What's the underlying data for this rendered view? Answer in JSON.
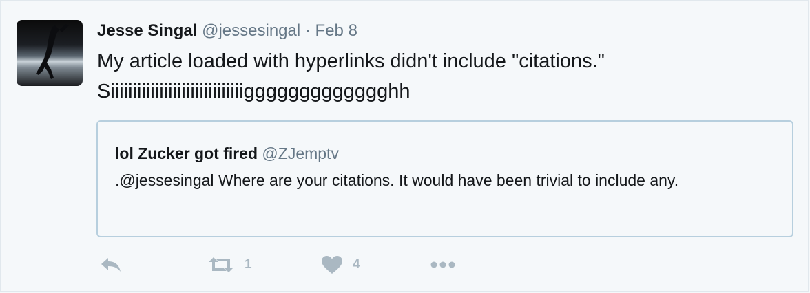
{
  "tweet": {
    "fullname": "Jesse Singal",
    "username": "@jessesingal",
    "separator": "·",
    "timestamp": "Feb 8",
    "text_line1": "My article loaded with hyperlinks didn't include \"citations.\"",
    "text_line2": "Siiiiiiiiiiiiiiiiiiiiiiiiiiiiiiggggggggggggghh"
  },
  "quoted_tweet": {
    "fullname": "lol Zucker got fired",
    "username": "@ZJemptv",
    "text": ".@jessesingal Where are your citations. It would have been trivial to include any."
  },
  "actions": {
    "retweet_count": "1",
    "like_count": "4"
  },
  "icons": {
    "reply": "reply-icon",
    "retweet": "retweet-icon",
    "like": "heart-icon",
    "more": "more-icon"
  },
  "colors": {
    "background": "#f5f8fa",
    "text": "#14171a",
    "secondary_text": "#657786",
    "action_icon": "#aab8c2",
    "quote_border": "#b7cfde"
  }
}
